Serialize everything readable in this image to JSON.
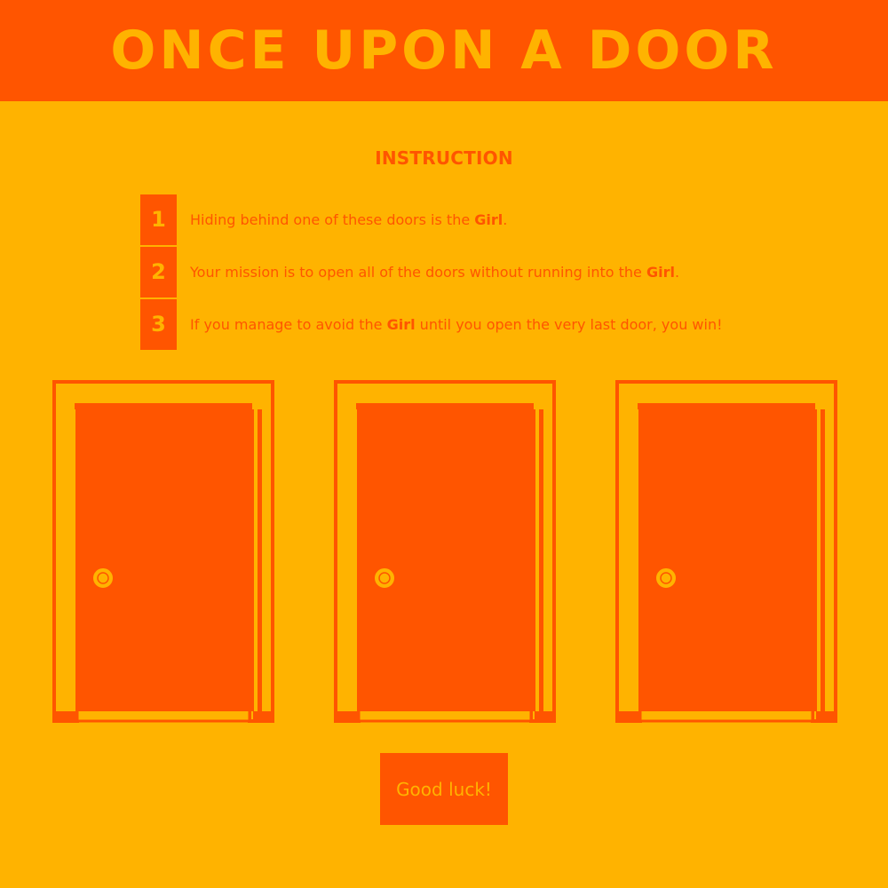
{
  "header": {
    "title": "ONCE UPON A DOOR"
  },
  "instructions": {
    "heading": "INSTRUCTION",
    "steps": [
      {
        "number": "1",
        "before": "Hiding behind one of these doors is the ",
        "emph": "Girl",
        "after": "."
      },
      {
        "number": "2",
        "before": "Your mission is to open all of the doors without running into the ",
        "emph": "Girl",
        "after": "."
      },
      {
        "number": "3",
        "before": "If you manage to avoid the ",
        "emph": "Girl",
        "after": " until you open the very last door, you win!"
      }
    ]
  },
  "doors": [
    {
      "name": "door-1"
    },
    {
      "name": "door-2"
    },
    {
      "name": "door-3"
    }
  ],
  "action": {
    "label": "Good luck!"
  },
  "colors": {
    "background": "#FFB300",
    "accent": "#FF5500"
  }
}
